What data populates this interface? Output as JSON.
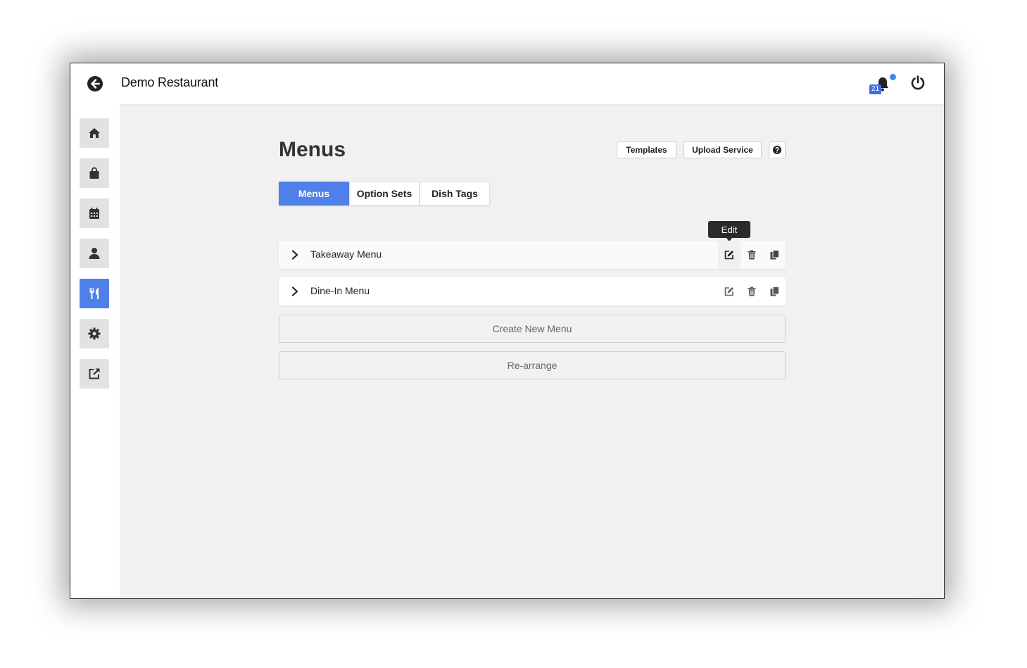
{
  "header": {
    "title": "Demo Restaurant",
    "notification_count": "21",
    "icons": {
      "back": "arrow-left-circle-icon",
      "bell": "bell-icon",
      "power": "power-icon"
    },
    "accent_color": "#4f7fe8"
  },
  "sidebar": {
    "items": [
      {
        "name": "home",
        "icon": "home-icon",
        "active": false
      },
      {
        "name": "orders",
        "icon": "shopping-bag-icon",
        "active": false
      },
      {
        "name": "bookings",
        "icon": "calendar-icon",
        "active": false
      },
      {
        "name": "customers",
        "icon": "user-icon",
        "active": false
      },
      {
        "name": "menus",
        "icon": "utensils-icon",
        "active": true
      },
      {
        "name": "settings",
        "icon": "gear-icon",
        "active": false
      },
      {
        "name": "external",
        "icon": "external-link-icon",
        "active": false
      }
    ]
  },
  "main": {
    "title": "Menus",
    "templates_label": "Templates",
    "upload_label": "Upload Service",
    "help_icon": "question-circle-icon",
    "tabs": [
      {
        "label": "Menus",
        "active": true
      },
      {
        "label": "Option Sets",
        "active": false
      },
      {
        "label": "Dish Tags",
        "active": false
      }
    ],
    "tooltip": "Edit",
    "menus": [
      {
        "label": "Takeaway Menu"
      },
      {
        "label": "Dine-In Menu"
      }
    ],
    "create_label": "Create New Menu",
    "rearrange_label": "Re-arrange"
  }
}
